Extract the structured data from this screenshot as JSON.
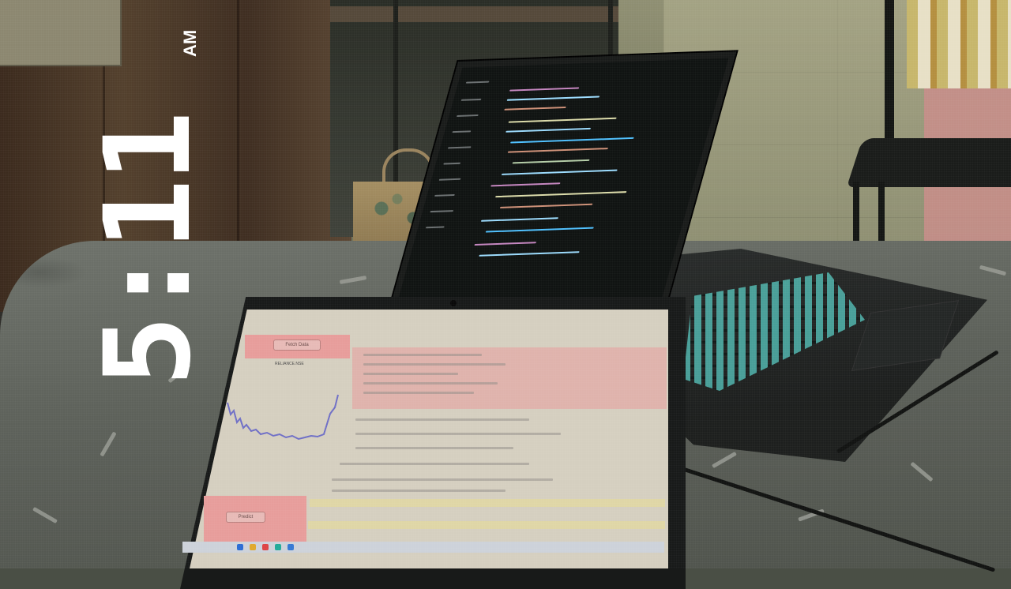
{
  "overlay": {
    "time": "5:11",
    "ampm": "AM",
    "time_color": "#ffffff"
  },
  "front_laptop": {
    "chart_title": "RELIANCE.NSE",
    "left_top_button": "Fetch Data",
    "left_bottom_button": "Predict",
    "accent_pink": "#e79d9b"
  },
  "back_laptop": {
    "app": "code editor",
    "keyboard_backlight": "#57c8c0"
  }
}
